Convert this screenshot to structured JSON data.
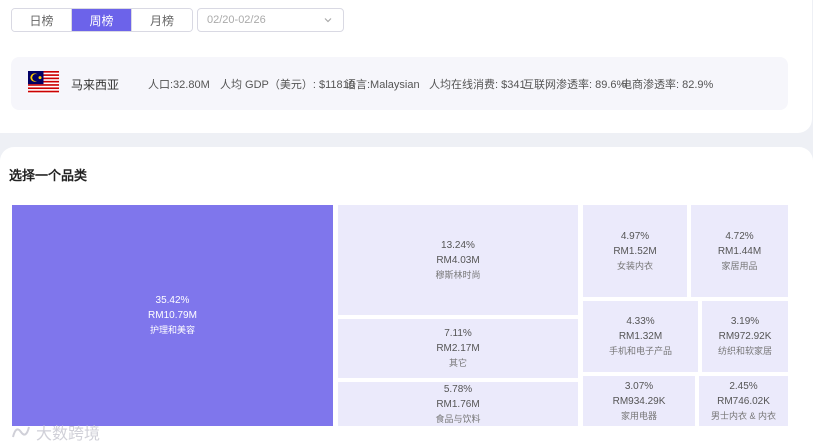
{
  "tabs": [
    {
      "label": "日榜",
      "active": false
    },
    {
      "label": "周榜",
      "active": true
    },
    {
      "label": "月榜",
      "active": false
    }
  ],
  "date_range": {
    "value": "02/20-02/26",
    "icon": "chevron-down-icon"
  },
  "country": {
    "flag_icon": "malaysia-flag-icon",
    "name": "马来西亚",
    "population": "人口:32.80M",
    "gdp": "人均 GDP（美元）: $11810",
    "language": "语言:Malaysian",
    "online_spend": "人均在线消费: $341",
    "internet_rate": "互联网渗透率: 89.6%",
    "ecommerce_rate": "电商渗透率: 82.9%"
  },
  "section_title": "选择一个品类",
  "categories": [
    {
      "pct": "35.42%",
      "amount": "RM10.79M",
      "name": "护理和美容"
    },
    {
      "pct": "13.24%",
      "amount": "RM4.03M",
      "name": "穆斯林时尚"
    },
    {
      "pct": "7.11%",
      "amount": "RM2.17M",
      "name": "其它"
    },
    {
      "pct": "5.78%",
      "amount": "RM1.76M",
      "name": "食品与饮料"
    },
    {
      "pct": "4.97%",
      "amount": "RM1.52M",
      "name": "女装内衣"
    },
    {
      "pct": "4.72%",
      "amount": "RM1.44M",
      "name": "家居用品"
    },
    {
      "pct": "4.33%",
      "amount": "RM1.32M",
      "name": "手机和电子产品"
    },
    {
      "pct": "3.19%",
      "amount": "RM972.92K",
      "name": "纺织和软家居"
    },
    {
      "pct": "3.07%",
      "amount": "RM934.29K",
      "name": "家用电器"
    },
    {
      "pct": "2.45%",
      "amount": "RM746.02K",
      "name": "男士内衣 & 内衣"
    }
  ],
  "watermark": "大数跨境",
  "colors": {
    "accent": "#6c63ea",
    "main_cell": "#7f76ec",
    "cell": "#ebeafb"
  }
}
